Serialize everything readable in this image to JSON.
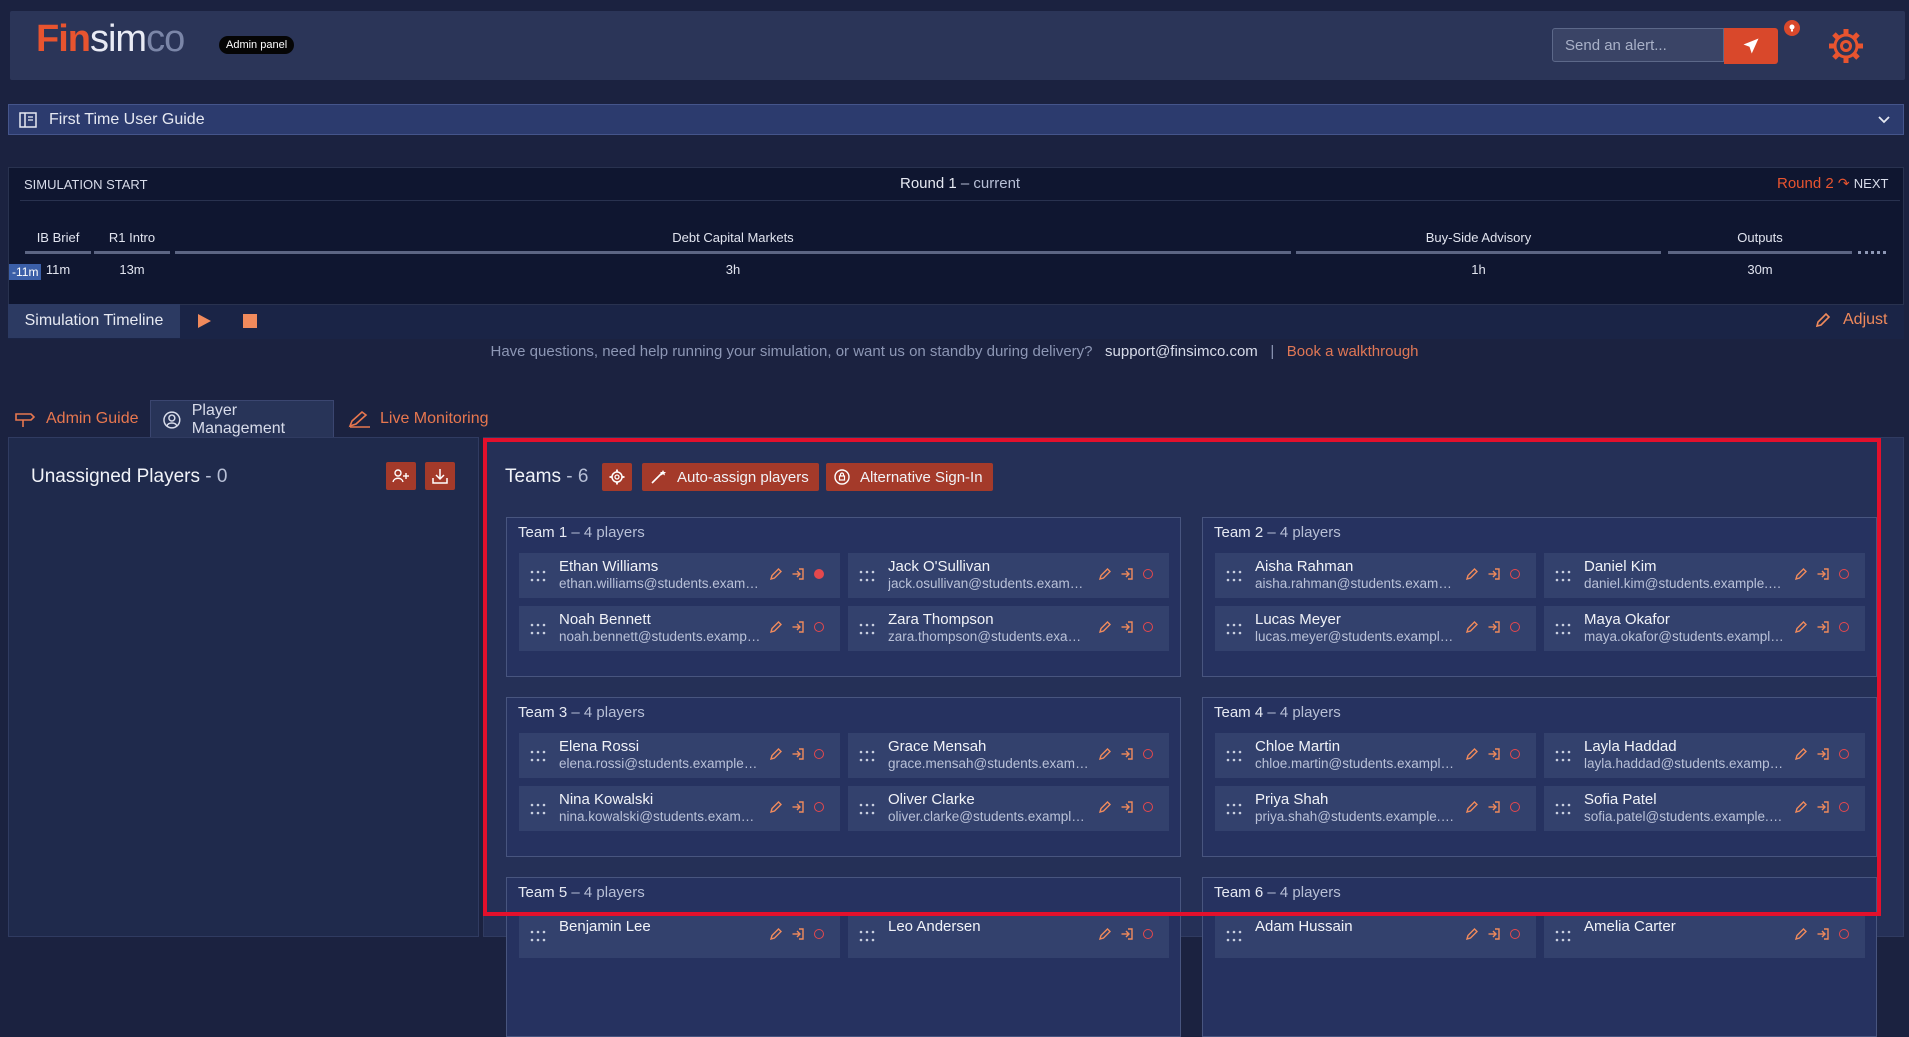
{
  "header": {
    "logo_fin": "Fin",
    "logo_sim": "sim",
    "logo_co": "co",
    "badge": "Admin panel",
    "alert_placeholder": "Send an alert..."
  },
  "guide": {
    "label": "First Time User Guide"
  },
  "timeline": {
    "start_label": "SIMULATION START",
    "round_current": "Round 1",
    "round_current_suffix": " – current",
    "round_next": "Round 2",
    "next_label": "NEXT",
    "offset": "-11m",
    "phases": [
      {
        "label": "IB Brief",
        "duration": "11m"
      },
      {
        "label": "R1 Intro",
        "duration": "13m"
      },
      {
        "label": "Debt Capital Markets",
        "duration": "3h"
      },
      {
        "label": "Buy-Side Advisory",
        "duration": "1h"
      },
      {
        "label": "Outputs",
        "duration": "30m"
      }
    ],
    "title": "Simulation Timeline",
    "adjust": "Adjust"
  },
  "help": {
    "text": "Have questions, need help running your simulation, or want us on standby during delivery?",
    "email": "support@finsimco.com",
    "separator": "|",
    "walkthrough": "Book a walkthrough"
  },
  "tabs": [
    {
      "label": "Admin Guide"
    },
    {
      "label": "Player Management"
    },
    {
      "label": "Live Monitoring"
    }
  ],
  "unassigned": {
    "title": "Unassigned Players",
    "count": " - 0"
  },
  "teams_header": {
    "title": "Teams",
    "count": " - 6",
    "auto_assign": "Auto-assign players",
    "alt_signin": "Alternative Sign-In"
  },
  "teams": [
    {
      "name": "Team 1",
      "count": " – 4 players",
      "players": [
        {
          "name": "Ethan Williams",
          "email": "ethan.williams@students.example.com",
          "online": true
        },
        {
          "name": "Jack O'Sullivan",
          "email": "jack.osullivan@students.example.com",
          "online": false
        },
        {
          "name": "Noah Bennett",
          "email": "noah.bennett@students.example.com",
          "online": false
        },
        {
          "name": "Zara Thompson",
          "email": "zara.thompson@students.example.com",
          "online": false
        }
      ]
    },
    {
      "name": "Team 2",
      "count": " – 4 players",
      "players": [
        {
          "name": "Aisha Rahman",
          "email": "aisha.rahman@students.example.com",
          "online": false
        },
        {
          "name": "Daniel Kim",
          "email": "daniel.kim@students.example.com",
          "online": false
        },
        {
          "name": "Lucas Meyer",
          "email": "lucas.meyer@students.example.com",
          "online": false
        },
        {
          "name": "Maya Okafor",
          "email": "maya.okafor@students.example.com",
          "online": false
        }
      ]
    },
    {
      "name": "Team 3",
      "count": " – 4 players",
      "players": [
        {
          "name": "Elena Rossi",
          "email": "elena.rossi@students.example.com",
          "online": false
        },
        {
          "name": "Grace Mensah",
          "email": "grace.mensah@students.example.com",
          "online": false
        },
        {
          "name": "Nina Kowalski",
          "email": "nina.kowalski@students.example.com",
          "online": false
        },
        {
          "name": "Oliver Clarke",
          "email": "oliver.clarke@students.example.com",
          "online": false
        }
      ]
    },
    {
      "name": "Team 4",
      "count": " – 4 players",
      "players": [
        {
          "name": "Chloe Martin",
          "email": "chloe.martin@students.example.com",
          "online": false
        },
        {
          "name": "Layla Haddad",
          "email": "layla.haddad@students.example.com",
          "online": false
        },
        {
          "name": "Priya Shah",
          "email": "priya.shah@students.example.com",
          "online": false
        },
        {
          "name": "Sofia Patel",
          "email": "sofia.patel@students.example.com",
          "online": false
        }
      ]
    },
    {
      "name": "Team 5",
      "count": " – 4 players",
      "players": [
        {
          "name": "Benjamin Lee",
          "email": "",
          "online": false
        },
        {
          "name": "Leo Andersen",
          "email": "",
          "online": false
        }
      ]
    },
    {
      "name": "Team 6",
      "count": " – 4 players",
      "players": [
        {
          "name": "Adam Hussain",
          "email": "",
          "online": false
        },
        {
          "name": "Amelia Carter",
          "email": "",
          "online": false
        }
      ]
    }
  ],
  "colors": {
    "accent": "#d9482b",
    "status": "#e5484d",
    "highlight": "#e3102c"
  }
}
